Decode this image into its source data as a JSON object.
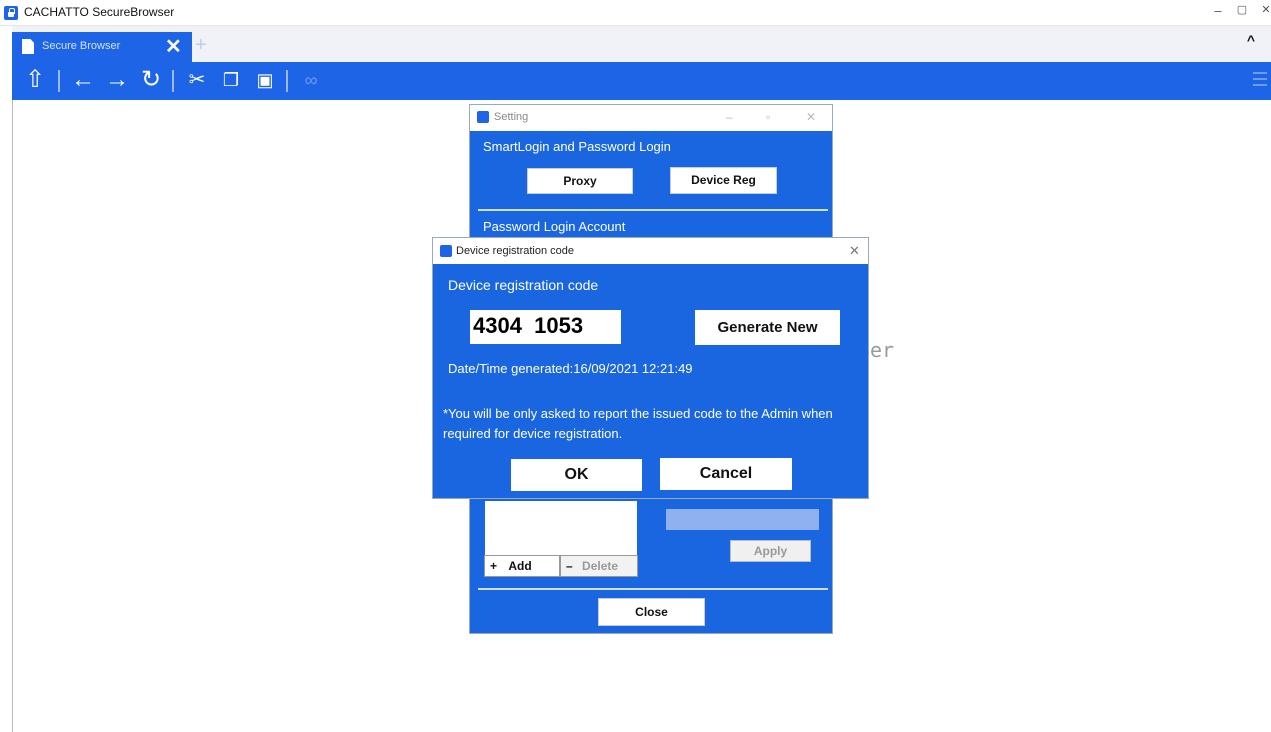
{
  "window": {
    "title": "CACHATTO SecureBrowser",
    "controls": {
      "minimize": "–",
      "maximize": "▢",
      "close": "✕"
    }
  },
  "tabs": {
    "active_title": "Secure Browser",
    "close_glyph": "✕",
    "new_tab_glyph": "+",
    "collapse_glyph": "^"
  },
  "toolbar": {
    "icons": [
      "home-icon",
      "back-icon",
      "forward-icon",
      "reload-icon",
      "cut-icon",
      "copy-icon",
      "paste-icon",
      "link-icon",
      "menu-icon"
    ]
  },
  "background": {
    "text_fragment": "er"
  },
  "setting_dialog": {
    "title": "Setting",
    "section1_label": "SmartLogin and Password Login",
    "proxy_button": "Proxy",
    "device_reg_button": "Device Reg",
    "section2_label": "Password Login Account",
    "add_button": "Add",
    "delete_button": "Delete",
    "apply_button": "Apply",
    "close_button": "Close"
  },
  "device_registration_dialog": {
    "title": "Device registration code",
    "heading": "Device registration code",
    "code": "4304  1053",
    "generate_button": "Generate New",
    "datetime": "Date/Time generated:16/09/2021 12:21:49",
    "note": "*You will be only asked to report the issued code to the Admin when required for device registration.",
    "ok_button": "OK",
    "cancel_button": "Cancel"
  },
  "colors": {
    "accent": "#1e64e6",
    "dialog_bg": "#1a66e0"
  }
}
